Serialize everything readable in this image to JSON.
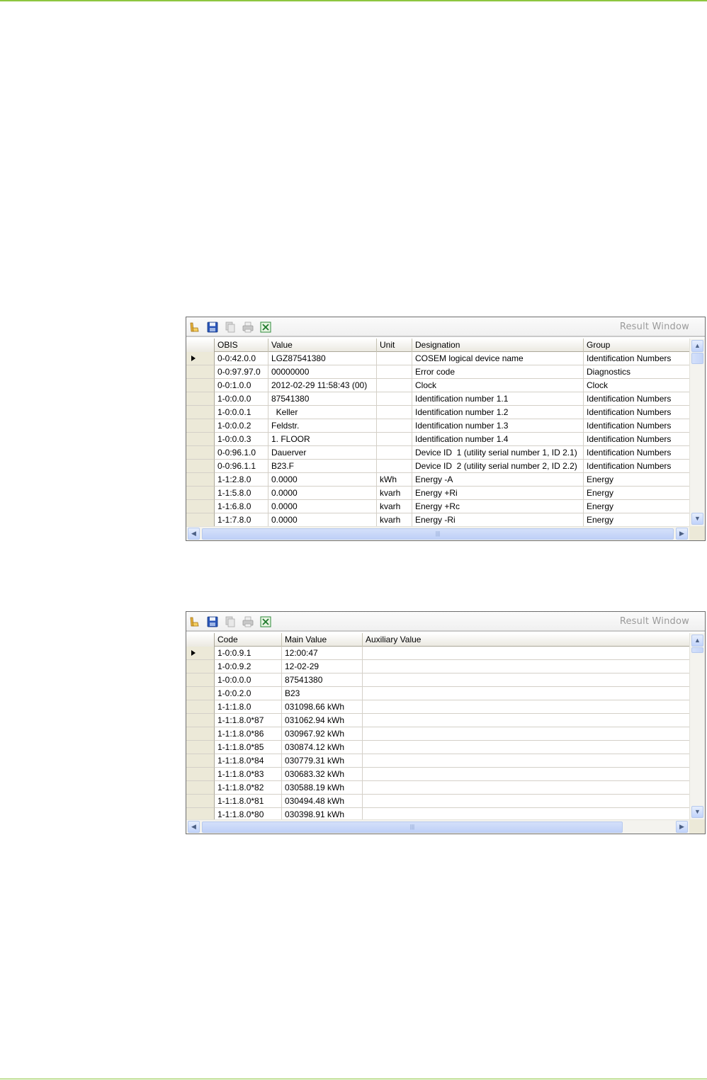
{
  "window_title": "Result Window",
  "toolbar_icons": [
    "open-folder-icon",
    "save-icon",
    "copy-icon",
    "print-icon",
    "excel-export-icon"
  ],
  "table1": {
    "columns": [
      "OBIS",
      "Value",
      "Unit",
      "Designation",
      "Group"
    ],
    "rows": [
      [
        "0-0:42.0.0",
        "LGZ87541380",
        "",
        "COSEM logical device name",
        "Identification Numbers"
      ],
      [
        "0-0:97.97.0",
        "00000000",
        "",
        "Error code",
        "Diagnostics"
      ],
      [
        "0-0:1.0.0",
        "2012-02-29 11:58:43 (00)",
        "",
        "Clock",
        "Clock"
      ],
      [
        "1-0:0.0.0",
        "87541380",
        "",
        "Identification number 1.1",
        "Identification Numbers"
      ],
      [
        "1-0:0.0.1",
        "  Keller",
        "",
        "Identification number 1.2",
        "Identification Numbers"
      ],
      [
        "1-0:0.0.2",
        "Feldstr.",
        "",
        "Identification number 1.3",
        "Identification Numbers"
      ],
      [
        "1-0:0.0.3",
        "1. FLOOR",
        "",
        "Identification number 1.4",
        "Identification Numbers"
      ],
      [
        "0-0:96.1.0",
        "Dauerver",
        "",
        "Device ID  1 (utility serial number 1, ID 2.1)",
        "Identification Numbers"
      ],
      [
        "0-0:96.1.1",
        "B23.F",
        "",
        "Device ID  2 (utility serial number 2, ID 2.2)",
        "Identification Numbers"
      ],
      [
        "1-1:2.8.0",
        "0.0000",
        "kWh",
        "Energy -A",
        "Energy"
      ],
      [
        "1-1:5.8.0",
        "0.0000",
        "kvarh",
        "Energy +Ri",
        "Energy"
      ],
      [
        "1-1:6.8.0",
        "0.0000",
        "kvarh",
        "Energy +Rc",
        "Energy"
      ],
      [
        "1-1:7.8.0",
        "0.0000",
        "kvarh",
        "Energy -Ri",
        "Energy"
      ]
    ]
  },
  "table2": {
    "columns": [
      "Code",
      "Main Value",
      "Auxiliary Value"
    ],
    "rows": [
      [
        "1-0:0.9.1",
        "12:00:47",
        ""
      ],
      [
        "1-0:0.9.2",
        "12-02-29",
        ""
      ],
      [
        "1-0:0.0.0",
        "87541380",
        ""
      ],
      [
        "1-0:0.2.0",
        "B23",
        ""
      ],
      [
        "1-1:1.8.0",
        "031098.66 kWh",
        ""
      ],
      [
        "1-1:1.8.0*87",
        "031062.94 kWh",
        ""
      ],
      [
        "1-1:1.8.0*86",
        "030967.92 kWh",
        ""
      ],
      [
        "1-1:1.8.0*85",
        "030874.12 kWh",
        ""
      ],
      [
        "1-1:1.8.0*84",
        "030779.31 kWh",
        ""
      ],
      [
        "1-1:1.8.0*83",
        "030683.32 kWh",
        ""
      ],
      [
        "1-1:1.8.0*82",
        "030588.19 kWh",
        ""
      ],
      [
        "1-1:1.8.0*81",
        "030494.48 kWh",
        ""
      ],
      [
        "1-1:1.8.0*80",
        "030398.91 kWh",
        ""
      ]
    ]
  },
  "scroll_arrows": {
    "up": "▲",
    "down": "▼",
    "left": "◀",
    "right": "▶",
    "grip": "|||"
  }
}
